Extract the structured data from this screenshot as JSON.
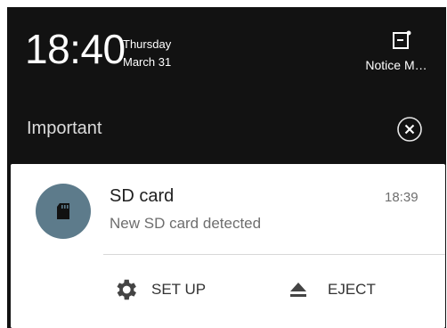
{
  "status": {
    "time": "18:40",
    "day": "Thursday",
    "date": "March 31"
  },
  "notice_button": {
    "label": "Notice M…",
    "icon": "notice-manager-icon"
  },
  "section": {
    "title": "Important",
    "dismiss_icon": "close-circle-icon"
  },
  "notification": {
    "icon": "sd-card-icon",
    "title": "SD card",
    "text": "New SD card detected",
    "time": "18:39",
    "actions": [
      {
        "label": "SET UP",
        "icon": "gear-icon"
      },
      {
        "label": "EJECT",
        "icon": "eject-icon"
      }
    ]
  },
  "colors": {
    "shade_background": "#121212",
    "card_background": "#ffffff",
    "avatar_background": "#5d7b8b"
  }
}
